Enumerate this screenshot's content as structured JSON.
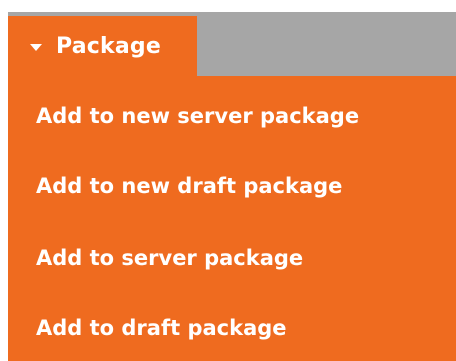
{
  "menu": {
    "title": "Package",
    "items": [
      {
        "label": "Add to new server package"
      },
      {
        "label": "Add to new draft package"
      },
      {
        "label": "Add to server package"
      },
      {
        "label": "Add to draft package"
      }
    ]
  },
  "colors": {
    "accent": "#ef6b1f",
    "header_gray": "#a6a6a6",
    "text": "#ffffff"
  },
  "icons": {
    "expand": "caret-down-icon"
  }
}
